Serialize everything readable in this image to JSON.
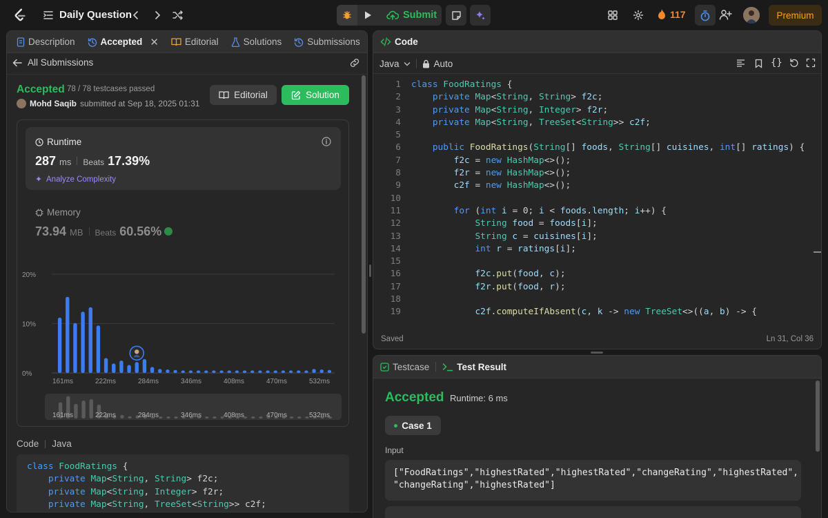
{
  "topbar": {
    "title": "Daily Question",
    "submit_label": "Submit",
    "streak_count": "117",
    "premium_label": "Premium"
  },
  "left": {
    "tabs": [
      "Description",
      "Accepted",
      "Editorial",
      "Solutions",
      "Submissions"
    ],
    "back_label": "All Submissions",
    "status": "Accepted",
    "testcases": "78 / 78 testcases passed",
    "author": "Mohd Saqib",
    "submitted_at": "submitted at Sep 18, 2025 01:31",
    "editorial_btn": "Editorial",
    "solution_btn": "Solution",
    "runtime": {
      "label": "Runtime",
      "value": "287",
      "unit": "ms",
      "beats_label": "Beats",
      "beats": "17.39%",
      "analyze": "Analyze Complexity"
    },
    "memory": {
      "label": "Memory",
      "value": "73.94",
      "unit": "MB",
      "beats_label": "Beats",
      "beats": "60.56%"
    },
    "code_header": "Code",
    "code_lang": "Java"
  },
  "chart_data": {
    "type": "bar",
    "title": "",
    "xlabel": "",
    "ylabel": "",
    "y_ticks": [
      "20%",
      "10%",
      "0%"
    ],
    "ylim": [
      0,
      20
    ],
    "x_tick_labels": [
      "161ms",
      "222ms",
      "284ms",
      "346ms",
      "408ms",
      "470ms",
      "532ms"
    ],
    "values": [
      11.2,
      15.4,
      10.1,
      12.4,
      13.3,
      9.6,
      3.0,
      1.9,
      2.5,
      1.6,
      2.2,
      2.8,
      1.2,
      0.8,
      0.7,
      0.6,
      0.5,
      0.5,
      0.5,
      0.5,
      0.5,
      0.5,
      0.5,
      0.5,
      0.5,
      0.5,
      0.5,
      0.5,
      0.5,
      0.5,
      0.5,
      0.5,
      0.5,
      0.8,
      0.7,
      0.6
    ],
    "highlight_index": 10,
    "colors": {
      "bar": "#3b7cf0",
      "minimap_bar": "#5a5a5a"
    }
  },
  "editor": {
    "header": "Code",
    "language": "Java",
    "mode": "Auto",
    "saved": "Saved",
    "cursor": "Ln 31, Col 36",
    "lines": [
      [
        [
          "kw",
          "class "
        ],
        [
          "ty",
          "FoodRatings"
        ],
        [
          "pl",
          " {"
        ]
      ],
      [
        [
          "pl",
          "    "
        ],
        [
          "kw",
          "private "
        ],
        [
          "ty",
          "Map"
        ],
        [
          "pl",
          "<"
        ],
        [
          "ty",
          "String"
        ],
        [
          "pl",
          ", "
        ],
        [
          "ty",
          "String"
        ],
        [
          "pl",
          "> "
        ],
        [
          "id",
          "f2c"
        ],
        [
          "pl",
          ";"
        ]
      ],
      [
        [
          "pl",
          "    "
        ],
        [
          "kw",
          "private "
        ],
        [
          "ty",
          "Map"
        ],
        [
          "pl",
          "<"
        ],
        [
          "ty",
          "String"
        ],
        [
          "pl",
          ", "
        ],
        [
          "ty",
          "Integer"
        ],
        [
          "pl",
          "> "
        ],
        [
          "id",
          "f2r"
        ],
        [
          "pl",
          ";"
        ]
      ],
      [
        [
          "pl",
          "    "
        ],
        [
          "kw",
          "private "
        ],
        [
          "ty",
          "Map"
        ],
        [
          "pl",
          "<"
        ],
        [
          "ty",
          "String"
        ],
        [
          "pl",
          ", "
        ],
        [
          "ty",
          "TreeSet"
        ],
        [
          "pl",
          "<"
        ],
        [
          "ty",
          "String"
        ],
        [
          "pl",
          ">> "
        ],
        [
          "id",
          "c2f"
        ],
        [
          "pl",
          ";"
        ]
      ],
      [
        [
          "pl",
          ""
        ]
      ],
      [
        [
          "pl",
          "    "
        ],
        [
          "kw",
          "public "
        ],
        [
          "fn",
          "FoodRatings"
        ],
        [
          "pl",
          "("
        ],
        [
          "ty",
          "String"
        ],
        [
          "pl",
          "[] "
        ],
        [
          "id",
          "foods"
        ],
        [
          "pl",
          ", "
        ],
        [
          "ty",
          "String"
        ],
        [
          "pl",
          "[] "
        ],
        [
          "id",
          "cuisines"
        ],
        [
          "pl",
          ", "
        ],
        [
          "kw",
          "int"
        ],
        [
          "pl",
          "[] "
        ],
        [
          "id",
          "ratings"
        ],
        [
          "pl",
          ") {"
        ]
      ],
      [
        [
          "pl",
          "        "
        ],
        [
          "id",
          "f2c"
        ],
        [
          "pl",
          " = "
        ],
        [
          "kw",
          "new "
        ],
        [
          "ty",
          "HashMap"
        ],
        [
          "pl",
          "<>();"
        ]
      ],
      [
        [
          "pl",
          "        "
        ],
        [
          "id",
          "f2r"
        ],
        [
          "pl",
          " = "
        ],
        [
          "kw",
          "new "
        ],
        [
          "ty",
          "HashMap"
        ],
        [
          "pl",
          "<>();"
        ]
      ],
      [
        [
          "pl",
          "        "
        ],
        [
          "id",
          "c2f"
        ],
        [
          "pl",
          " = "
        ],
        [
          "kw",
          "new "
        ],
        [
          "ty",
          "HashMap"
        ],
        [
          "pl",
          "<>();"
        ]
      ],
      [
        [
          "pl",
          ""
        ]
      ],
      [
        [
          "pl",
          "        "
        ],
        [
          "kw",
          "for "
        ],
        [
          "pl",
          "("
        ],
        [
          "kw",
          "int "
        ],
        [
          "id",
          "i"
        ],
        [
          "pl",
          " = 0; "
        ],
        [
          "id",
          "i"
        ],
        [
          "pl",
          " < "
        ],
        [
          "id",
          "foods"
        ],
        [
          "pl",
          "."
        ],
        [
          "id",
          "length"
        ],
        [
          "pl",
          "; "
        ],
        [
          "id",
          "i"
        ],
        [
          "pl",
          "++) {"
        ]
      ],
      [
        [
          "pl",
          "            "
        ],
        [
          "ty",
          "String "
        ],
        [
          "id",
          "food"
        ],
        [
          "pl",
          " = "
        ],
        [
          "id",
          "foods"
        ],
        [
          "pl",
          "["
        ],
        [
          "id",
          "i"
        ],
        [
          "pl",
          "];"
        ]
      ],
      [
        [
          "pl",
          "            "
        ],
        [
          "ty",
          "String "
        ],
        [
          "id",
          "c"
        ],
        [
          "pl",
          " = "
        ],
        [
          "id",
          "cuisines"
        ],
        [
          "pl",
          "["
        ],
        [
          "id",
          "i"
        ],
        [
          "pl",
          "];"
        ]
      ],
      [
        [
          "pl",
          "            "
        ],
        [
          "kw",
          "int "
        ],
        [
          "id",
          "r"
        ],
        [
          "pl",
          " = "
        ],
        [
          "id",
          "ratings"
        ],
        [
          "pl",
          "["
        ],
        [
          "id",
          "i"
        ],
        [
          "pl",
          "];"
        ]
      ],
      [
        [
          "pl",
          ""
        ]
      ],
      [
        [
          "pl",
          "            "
        ],
        [
          "id",
          "f2c"
        ],
        [
          "pl",
          "."
        ],
        [
          "fn",
          "put"
        ],
        [
          "pl",
          "("
        ],
        [
          "id",
          "food"
        ],
        [
          "pl",
          ", "
        ],
        [
          "id",
          "c"
        ],
        [
          "pl",
          ");"
        ]
      ],
      [
        [
          "pl",
          "            "
        ],
        [
          "id",
          "f2r"
        ],
        [
          "pl",
          "."
        ],
        [
          "fn",
          "put"
        ],
        [
          "pl",
          "("
        ],
        [
          "id",
          "food"
        ],
        [
          "pl",
          ", "
        ],
        [
          "id",
          "r"
        ],
        [
          "pl",
          ");"
        ]
      ],
      [
        [
          "pl",
          ""
        ]
      ],
      [
        [
          "pl",
          "            "
        ],
        [
          "id",
          "c2f"
        ],
        [
          "pl",
          "."
        ],
        [
          "fn",
          "computeIfAbsent"
        ],
        [
          "pl",
          "("
        ],
        [
          "id",
          "c"
        ],
        [
          "pl",
          ", "
        ],
        [
          "id",
          "k"
        ],
        [
          "pl",
          " -> "
        ],
        [
          "kw",
          "new "
        ],
        [
          "ty",
          "TreeSet"
        ],
        [
          "pl",
          "<>(("
        ],
        [
          "id",
          "a"
        ],
        [
          "pl",
          ", "
        ],
        [
          "id",
          "b"
        ],
        [
          "pl",
          ") -> {"
        ]
      ]
    ]
  },
  "left_code_lines": [
    [
      [
        "kw",
        "class "
      ],
      [
        "ty",
        "FoodRatings"
      ],
      [
        "pl",
        " {"
      ]
    ],
    [
      [
        "pl",
        "    "
      ],
      [
        "kw",
        "private "
      ],
      [
        "ty",
        "Map"
      ],
      [
        "pl",
        "<"
      ],
      [
        "ty",
        "String"
      ],
      [
        "pl",
        ", "
      ],
      [
        "ty",
        "String"
      ],
      [
        "pl",
        "> "
      ],
      [
        "pl",
        "f2c;"
      ]
    ],
    [
      [
        "pl",
        "    "
      ],
      [
        "kw",
        "private "
      ],
      [
        "ty",
        "Map"
      ],
      [
        "pl",
        "<"
      ],
      [
        "ty",
        "String"
      ],
      [
        "pl",
        ", "
      ],
      [
        "ty",
        "Integer"
      ],
      [
        "pl",
        "> "
      ],
      [
        "pl",
        "f2r;"
      ]
    ],
    [
      [
        "pl",
        "    "
      ],
      [
        "kw",
        "private "
      ],
      [
        "ty",
        "Map"
      ],
      [
        "pl",
        "<"
      ],
      [
        "ty",
        "String"
      ],
      [
        "pl",
        ", "
      ],
      [
        "ty",
        "TreeSet"
      ],
      [
        "pl",
        "<"
      ],
      [
        "ty",
        "String"
      ],
      [
        "pl",
        ">> "
      ],
      [
        "pl",
        "c2f;"
      ]
    ]
  ],
  "testpanel": {
    "tab_testcase": "Testcase",
    "tab_result": "Test Result",
    "status": "Accepted",
    "runtime": "Runtime: 6 ms",
    "case_label": "Case 1",
    "input_label": "Input",
    "input_line1": "[\"FoodRatings\",\"highestRated\",\"highestRated\",\"changeRating\",\"highestRated\",",
    "input_line2": "\"changeRating\",\"highestRated\"]"
  }
}
